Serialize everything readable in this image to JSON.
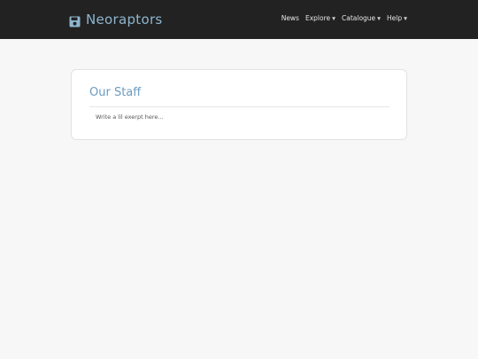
{
  "header": {
    "brand_icon": "floppy-disk-icon",
    "brand_name": "Neoraptors",
    "nav": [
      {
        "label": "News",
        "has_dropdown": false
      },
      {
        "label": "Explore",
        "has_dropdown": true
      },
      {
        "label": "Catalogue",
        "has_dropdown": true
      },
      {
        "label": "Help",
        "has_dropdown": true
      }
    ],
    "dropdown_icon": "chevron-down-icon"
  },
  "main": {
    "title": "Our Staff",
    "excerpt": "Write a lil exerpt here..."
  },
  "colors": {
    "navbar_bg": "#222222",
    "brand": "#8eb6cf",
    "title": "#6a9cc0",
    "page_bg": "#f7f7f7"
  }
}
